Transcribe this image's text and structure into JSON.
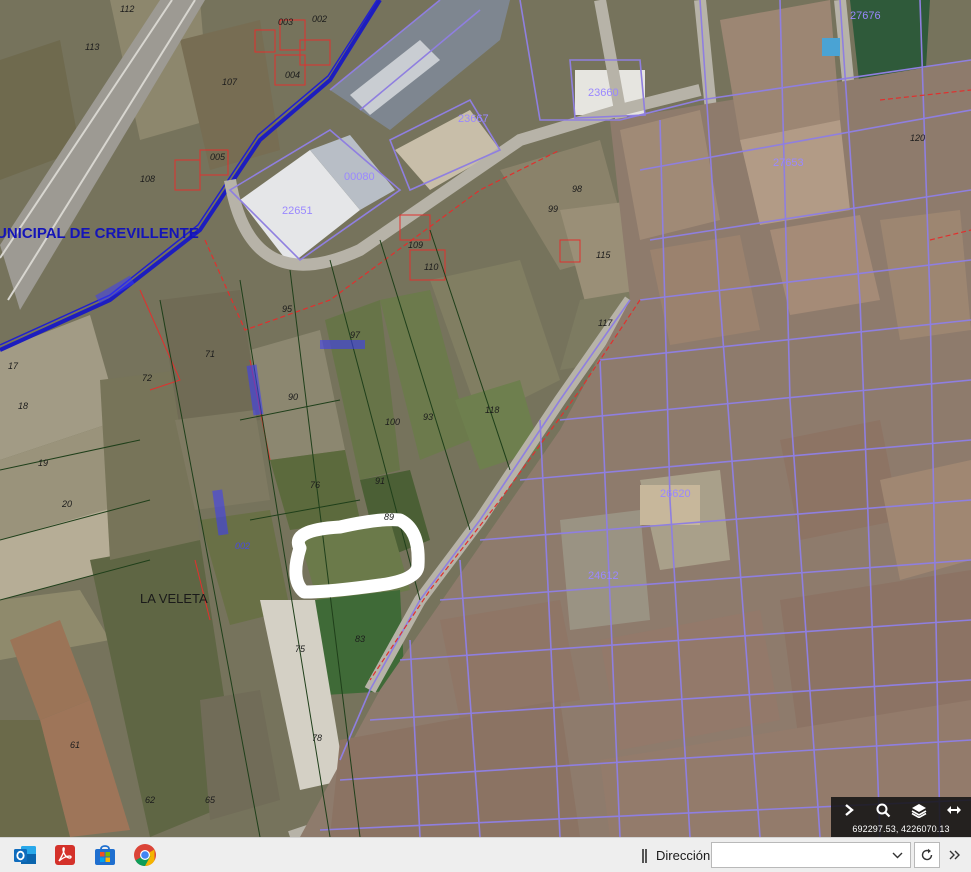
{
  "map": {
    "place_label": "LA VELETA",
    "road_label": "UNICIPAL DE CREVILLENTE",
    "parcel_labels": [
      {
        "text": "112"
      },
      {
        "text": "113"
      },
      {
        "text": "107"
      },
      {
        "text": "003"
      },
      {
        "text": "002"
      },
      {
        "text": "004"
      },
      {
        "text": "005"
      },
      {
        "text": "108"
      },
      {
        "text": "109"
      },
      {
        "text": "110"
      },
      {
        "text": "22651"
      },
      {
        "text": "00080"
      },
      {
        "text": "23667"
      },
      {
        "text": "23660"
      },
      {
        "text": "98"
      },
      {
        "text": "99"
      },
      {
        "text": "115"
      },
      {
        "text": "117"
      },
      {
        "text": "97"
      },
      {
        "text": "95"
      },
      {
        "text": "90"
      },
      {
        "text": "93"
      },
      {
        "text": "100"
      },
      {
        "text": "118"
      },
      {
        "text": "71"
      },
      {
        "text": "72"
      },
      {
        "text": "18"
      },
      {
        "text": "19"
      },
      {
        "text": "20"
      },
      {
        "text": "17"
      },
      {
        "text": "91"
      },
      {
        "text": "89"
      },
      {
        "text": "76"
      },
      {
        "text": "002"
      },
      {
        "text": "75"
      },
      {
        "text": "83"
      },
      {
        "text": "78"
      },
      {
        "text": "65"
      },
      {
        "text": "62"
      },
      {
        "text": "61"
      },
      {
        "text": "120"
      },
      {
        "text": "27676"
      },
      {
        "text": "26620"
      },
      {
        "text": "27653"
      },
      {
        "text": "24612"
      }
    ]
  },
  "tools": {
    "buttons": [
      {
        "name": "expand",
        "icon": "chevron-right-icon"
      },
      {
        "name": "search",
        "icon": "search-icon"
      },
      {
        "name": "layers",
        "icon": "layers-icon"
      },
      {
        "name": "measure",
        "icon": "arrows-horizontal-icon"
      }
    ],
    "coordinates": "692297.53, 4226070.13"
  },
  "taskbar": {
    "apps": [
      {
        "name": "outlook",
        "icon": "outlook-icon",
        "color": "#0f6cbd"
      },
      {
        "name": "acrobat",
        "icon": "pdf-icon",
        "color": "#d4312a"
      },
      {
        "name": "store",
        "icon": "store-icon",
        "color": "#1f6fcf"
      },
      {
        "name": "chrome",
        "icon": "chrome-icon",
        "color": "#2f9a48"
      }
    ],
    "address_label": "Dirección",
    "address_value": "",
    "address_placeholder": ""
  },
  "colors": {
    "parcel_line": "#8f7fe0",
    "boundary_blue": "#1d1dbf",
    "highlight_circle": "#ffffff",
    "field_green": "#5d6f3d"
  }
}
